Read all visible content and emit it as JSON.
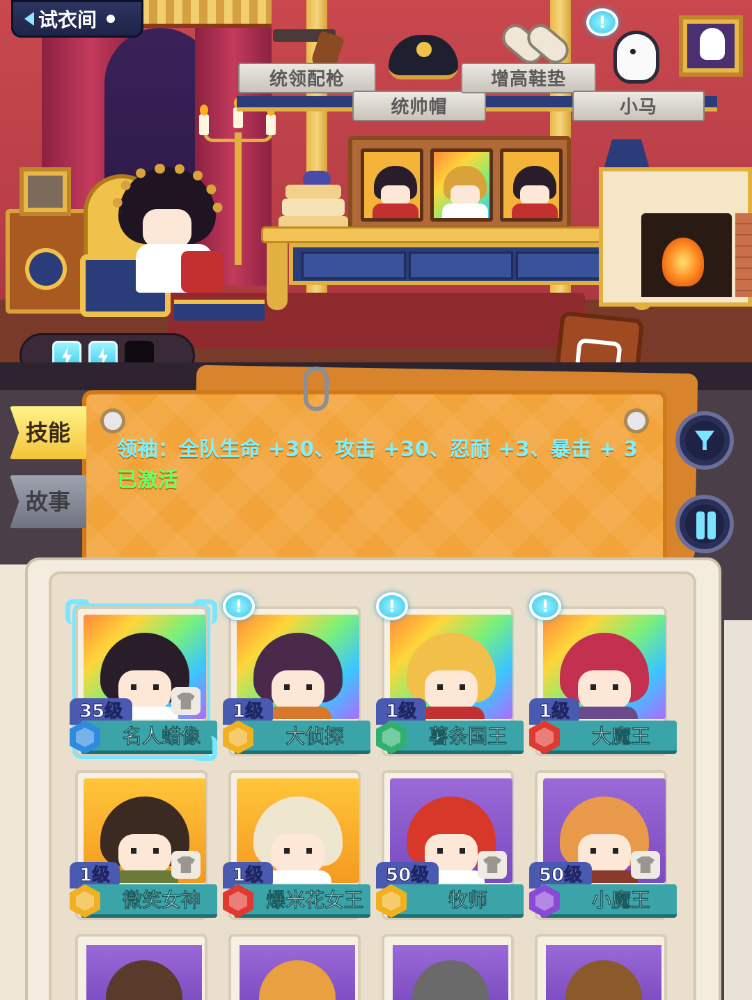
{
  "header": {
    "back_label": "试衣间"
  },
  "accessories": [
    {
      "label": "统领配枪",
      "icon": "pistol-icon"
    },
    {
      "label": "统帅帽",
      "icon": "bicorne-hat-icon"
    },
    {
      "label": "增高鞋垫",
      "icon": "insole-icon"
    },
    {
      "label": "小马",
      "icon": "pony-icon"
    }
  ],
  "energy": {
    "filled": 2,
    "total": 3
  },
  "tabs": {
    "skill": "技能",
    "story": "故事"
  },
  "skill": {
    "description": "领袖：全队生命 +30、攻击 +30、忍耐 +3、暴击 + 3",
    "status": "已激活"
  },
  "colors": {
    "accent": "#7ae6ff",
    "skill_text": "#7cf2ff",
    "active_text": "#6dff6a",
    "tab_active": "#f3c33a"
  },
  "characters": [
    {
      "level": "35级",
      "name": "名人蜡像",
      "role_color": "#2f8be0",
      "frame": "rainbow",
      "selected": true,
      "notice": false,
      "has_outfit": true
    },
    {
      "level": "1级",
      "name": "大侦探",
      "role_color": "#f0b020",
      "frame": "rainbow",
      "selected": false,
      "notice": true,
      "has_outfit": false
    },
    {
      "level": "1级",
      "name": "薯条国王",
      "role_color": "#2fb070",
      "frame": "rainbow",
      "selected": false,
      "notice": true,
      "has_outfit": false
    },
    {
      "level": "1级",
      "name": "大魔王",
      "role_color": "#e03a30",
      "frame": "rainbow",
      "selected": false,
      "notice": true,
      "has_outfit": false
    },
    {
      "level": "1级",
      "name": "微笑女神",
      "role_color": "#f0b020",
      "frame": "gold",
      "selected": false,
      "notice": false,
      "has_outfit": true
    },
    {
      "level": "1级",
      "name": "爆米花女王",
      "role_color": "#e03a30",
      "frame": "gold",
      "selected": false,
      "notice": false,
      "has_outfit": false
    },
    {
      "level": "50级",
      "name": "牧师",
      "role_color": "#f0b020",
      "frame": "purple",
      "selected": false,
      "notice": false,
      "has_outfit": true
    },
    {
      "level": "50级",
      "name": "小魔王",
      "role_color": "#8a4ad8",
      "frame": "purple",
      "selected": false,
      "notice": false,
      "has_outfit": true
    }
  ]
}
